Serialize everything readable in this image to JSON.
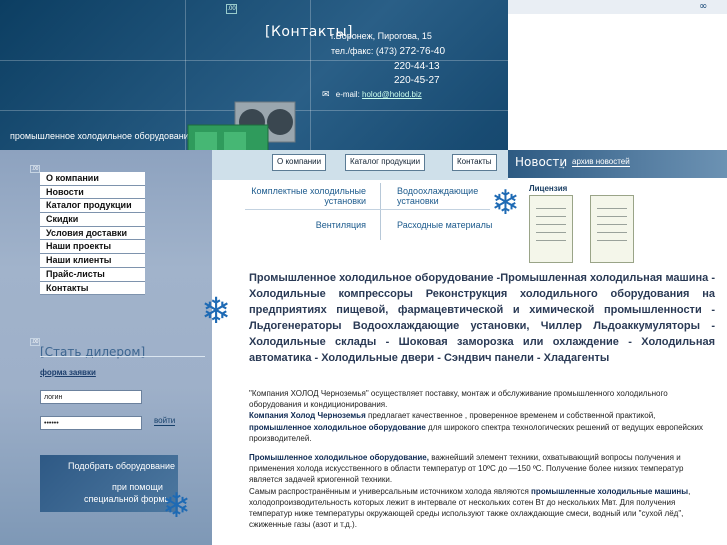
{
  "header": {
    "contacts_title": "[Контакты]",
    "address": "г.Воронеж, Пирогова, 15",
    "phone_label": "тел./факс: (473)",
    "phones": [
      "272-76-40",
      "220-44-13",
      "220-45-27"
    ],
    "email_label": "e-mail:",
    "email": "holod@holod.biz",
    "slogan": "промышленное холодильное оборудование",
    "top_icon": "∞"
  },
  "nav": {
    "about": "О компании",
    "catalog": "Каталог продукции",
    "contacts": "Контакты"
  },
  "news": {
    "title": "Новости",
    "arrow": "→",
    "archive": "архив новостей"
  },
  "menu": [
    "О компании",
    "Новости",
    "Каталог продукции",
    "Скидки",
    "Условия доставки",
    "Наши проекты",
    "Наши клиенты",
    "Прайс-листы",
    "Контакты"
  ],
  "categories": {
    "c1": "Комплектные холодильные установки",
    "c2": "Водоохлаждающие установки",
    "c3": "Вентиляция",
    "c4": "Расходные материалы"
  },
  "license": {
    "label": "Лицензия"
  },
  "dealer": {
    "title": "[Стать дилером]",
    "form_link": "форма заявки",
    "login_placeholder": "логин",
    "password_value": "••••••",
    "login_button": "войти"
  },
  "equip_box": {
    "line1": "Подобрать оборудование",
    "line2": "при помощи",
    "line3": "специальной формы"
  },
  "keywords": "Промышленное холодильное оборудование -Промышленная холодильная машина - Холодильные компрессоры Реконструкция холодильного оборудования на предприятиях пищевой, фармацевтической и химической промышленности - Льдогенераторы Водоохлаждающие установки, Чиллер Льдоаккумуляторы - Холодильные склады - Шоковая заморозка или охлаждение - Холодильная автоматика - Холодильные двери - Сэндвич панели - Хладагенты",
  "text": {
    "p1a": "\"Компания ХОЛОД Черноземья\" осуществляет поставку, монтаж и обслуживание промышленного холодильного оборудования и кондиционирования.",
    "p1b_bold": "Компания Холод Черноземья",
    "p1b": " предлагает качественное , проверенное временем и собственной практикой, ",
    "p1c_bold": "промышленное холодильное оборудование",
    "p1c": " для широкого спектра технологических решений от ведущих европейских производителей.",
    "p2_bold": "Промышленное холодильное оборудование,",
    "p2": " важнейший элемент техники, охватывающий вопросы получения и применения холода искусственного в области температур от 10ºС до —150 ºС. Получение более низких температур является задачей криогенной техники.",
    "p3a": "Самым распространённым и универсальным источником холода являются ",
    "p3_bold": "промышленные холодильные машины",
    "p3b": ", холодопроизводительность которых лежит в интервале от нескольких сотен Вт до нескольких Мвт. Для получения температур ниже температуры окружающей среды используют также охлаждающие смеси, водный или \"сухой лёд\", сжиженные газы (азот и т.д.)."
  },
  "colors": {
    "header_blue": "#184b72",
    "panel": "#9eb0c9",
    "accent": "#1e6ab4"
  }
}
